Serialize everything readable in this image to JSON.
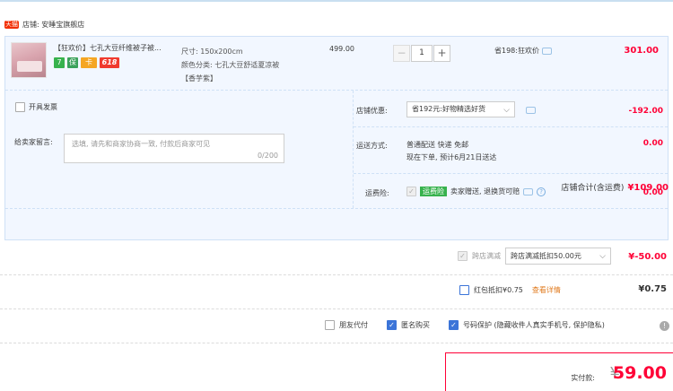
{
  "store": {
    "badge": "天猫",
    "name": "店铺: 安睡宝旗舰店"
  },
  "item": {
    "title": "【狂欢价】七孔大豆纤维被子被...",
    "tags": [
      "7",
      "保",
      "卡",
      "618"
    ],
    "sku_size": "尺寸: 150x200cm",
    "sku_color": "颜色分类: 七孔大豆舒适夏凉被",
    "sku_color2": "【香芋紫】",
    "price": "499.00",
    "quantity": "1",
    "minus": "−",
    "plus": "+",
    "promo": "省198:狂欢价",
    "subtotal": "301.00"
  },
  "invoice": {
    "label": "开具发票"
  },
  "message": {
    "label": "给卖家留言:",
    "placeholder": "选填, 请先和商家协商一致, 付款后商家可见",
    "count": "0/200"
  },
  "coupon": {
    "label": "店铺优惠:",
    "selected": "省192元:好物精选好货",
    "amount": "-192.00"
  },
  "shipping": {
    "label": "运送方式:",
    "line1": "普通配送 快递 免邮",
    "line2": "现在下单, 预计6月21日送达",
    "amount": "0.00"
  },
  "insurance": {
    "label": "运费险:",
    "badge": "运费险",
    "text": "卖家赠送, 退换货可赔",
    "amount": "0.00"
  },
  "store_total": {
    "label": "店铺合计(含运费)",
    "value": "¥109.00"
  },
  "cross_store": {
    "label": "跨店满减",
    "selected": "跨店满减抵扣50.00元",
    "amount": "¥-50.00"
  },
  "red_packet": {
    "label": "红包抵扣¥0.75",
    "detail": "查看详情",
    "amount": "¥0.75"
  },
  "options": {
    "friend_pay": "朋友代付",
    "anonymous": "匿名购买",
    "number_protect": "号码保护 (隐藏收件人真实手机号, 保护隐私)"
  },
  "payment": {
    "label": "实付款:",
    "currency": "¥",
    "value": "59.00"
  },
  "colors": {
    "accent": "#ff0036",
    "panel": "#f2f7ff",
    "border": "#cfe1f6"
  }
}
